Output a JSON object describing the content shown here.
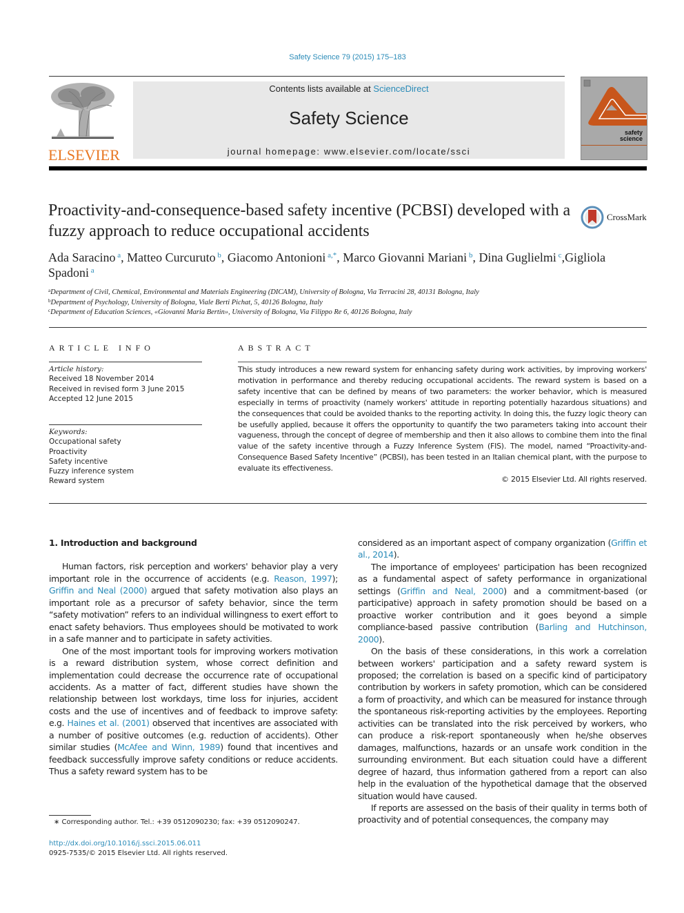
{
  "header": {
    "citation": "Safety Science 79 (2015) 175–183",
    "contents_prefix": "Contents lists available at ",
    "contents_link": "ScienceDirect",
    "journal_title": "Safety Science",
    "homepage": "journal homepage: www.elsevier.com/locate/ssci",
    "publisher_logo_text": "ELSEVIER",
    "cover_text_line1": "safety",
    "cover_text_line2": "science"
  },
  "colors": {
    "link": "#2a8bb8",
    "elsevier_orange": "#e87722",
    "cover_orange": "#c8561b",
    "header_box_bg": "#e8e8e8"
  },
  "article": {
    "title": "Proactivity-and-consequence-based safety incentive (PCBSI) developed with a fuzzy approach to reduce occupational accidents",
    "crossmark_label": "CrossMark",
    "authors": [
      {
        "name": "Ada Saracino",
        "sup": "a",
        "sep": ", "
      },
      {
        "name": "Matteo Curcuruto",
        "sup": "b",
        "sep": ", "
      },
      {
        "name": "Giacomo Antonioni",
        "sup": "a,*",
        "sep": ", "
      },
      {
        "name": "Marco Giovanni Mariani",
        "sup": "b",
        "sep": ", "
      },
      {
        "name": "Dina Guglielmi",
        "sup": "c",
        "sep": ","
      },
      {
        "name": "Gigliola Spadoni",
        "sup": "a",
        "sep": ""
      }
    ],
    "affiliations": [
      {
        "key": "a",
        "text": "Department of Civil, Chemical, Environmental and Materials Engineering (DICAM), University of Bologna, Via Terracini 28, 40131 Bologna, Italy"
      },
      {
        "key": "b",
        "text": "Department of Psychology, University of Bologna, Viale Berti Pichat, 5, 40126 Bologna, Italy"
      },
      {
        "key": "c",
        "text": "Department of Education Sciences, «Giovanni Maria Bertin», University of Bologna, Via Filippo Re 6, 40126 Bologna, Italy"
      }
    ]
  },
  "article_info": {
    "heading": "ARTICLE INFO",
    "history_label": "Article history:",
    "history": [
      "Received 18 November 2014",
      "Received in revised form 3 June 2015",
      "Accepted 12 June 2015"
    ],
    "keywords_label": "Keywords:",
    "keywords": [
      "Occupational safety",
      "Proactivity",
      "Safety incentive",
      "Fuzzy inference system",
      "Reward system"
    ]
  },
  "abstract": {
    "heading": "ABSTRACT",
    "text": "This study introduces a new reward system for enhancing safety during work activities, by improving workers' motivation in performance and thereby reducing occupational accidents. The reward system is based on a safety incentive that can be defined by means of two parameters: the worker behavior, which is measured especially in terms of proactivity (namely workers' attitude in reporting potentially hazardous situations) and the consequences that could be avoided thanks to the reporting activity. In doing this, the fuzzy logic theory can be usefully applied, because it offers the opportunity to quantify the two parameters taking into account their vagueness, through the concept of degree of membership and then it also allows to combine them into the final value of the safety incentive through a Fuzzy Inference System (FIS). The model, named “Proactivity-and-Consequence Based Safety Incentive” (PCBSI), has been tested in an Italian chemical plant, with the purpose to evaluate its effectiveness.",
    "copyright": "© 2015 Elsevier Ltd. All rights reserved."
  },
  "body": {
    "section_heading": "1. Introduction and background",
    "left_p1": [
      {
        "t": "Human factors, risk perception and workers' behavior play a very important role in the occurrence of accidents (e.g. "
      },
      {
        "t": "Reason, 1997",
        "link": true
      },
      {
        "t": "); "
      },
      {
        "t": "Griffin and Neal (2000)",
        "link": true
      },
      {
        "t": " argued that safety motivation also plays an important role as a precursor of safety behavior, since the term “safety motivation” refers to an individual willingness to exert effort to enact safety behaviors. Thus employees should be motivated to work in a safe manner and to participate in safety activities."
      }
    ],
    "left_p2": [
      {
        "t": "One of the most important tools for improving workers motivation is a reward distribution system, whose correct definition and implementation could decrease the occurrence rate of occupational accidents. As a matter of fact, different studies have shown the relationship between lost workdays, time loss for injuries, accident costs and the use of incentives and of feedback to improve safety: e.g. "
      },
      {
        "t": "Haines et al. (2001)",
        "link": true
      },
      {
        "t": " observed that incentives are associated with a number of positive outcomes (e.g. reduction of accidents). Other similar studies ("
      },
      {
        "t": "McAfee and Winn, 1989",
        "link": true
      },
      {
        "t": ") found that incentives and feedback successfully improve safety conditions or reduce accidents. Thus a safety reward system has to be"
      }
    ],
    "right_p1": [
      {
        "t": "considered as an important aspect of company organization ("
      },
      {
        "t": "Griffin et al., 2014",
        "link": true
      },
      {
        "t": ")."
      }
    ],
    "right_p2": [
      {
        "t": "The importance of employees' participation has been recognized as a fundamental aspect of safety performance in organizational settings ("
      },
      {
        "t": "Griffin and Neal, 2000",
        "link": true
      },
      {
        "t": ") and a commitment-based (or participative) approach in safety promotion should be based on a proactive worker contribution and it goes beyond a simple compliance-based passive contribution ("
      },
      {
        "t": "Barling and Hutchinson, 2000",
        "link": true
      },
      {
        "t": ")."
      }
    ],
    "right_p3": [
      {
        "t": "On the basis of these considerations, in this work a correlation between workers' participation and a safety reward system is proposed; the correlation is based on a specific kind of participatory contribution by workers in safety promotion, which can be considered a form of proactivity, and which can be measured for instance through the spontaneous risk-reporting activities by the employees. Reporting activities can be translated into the risk perceived by workers, who can produce a risk-report spontaneously when he/she observes damages, malfunctions, hazards or an unsafe work condition in the surrounding environment. But each situation could have a different degree of hazard, thus information gathered from a report can also help in the evaluation of the hypothetical damage that the observed situation would have caused."
      }
    ],
    "right_p4": [
      {
        "t": "If reports are assessed on the basis of their quality in terms both of proactivity and of potential consequences, the company may"
      }
    ]
  },
  "footer": {
    "footnote": "∗ Corresponding author. Tel.: +39 0512090230; fax: +39 0512090247.",
    "doi": "http://dx.doi.org/10.1016/j.ssci.2015.06.011",
    "issn": "0925-7535/© 2015 Elsevier Ltd. All rights reserved."
  }
}
